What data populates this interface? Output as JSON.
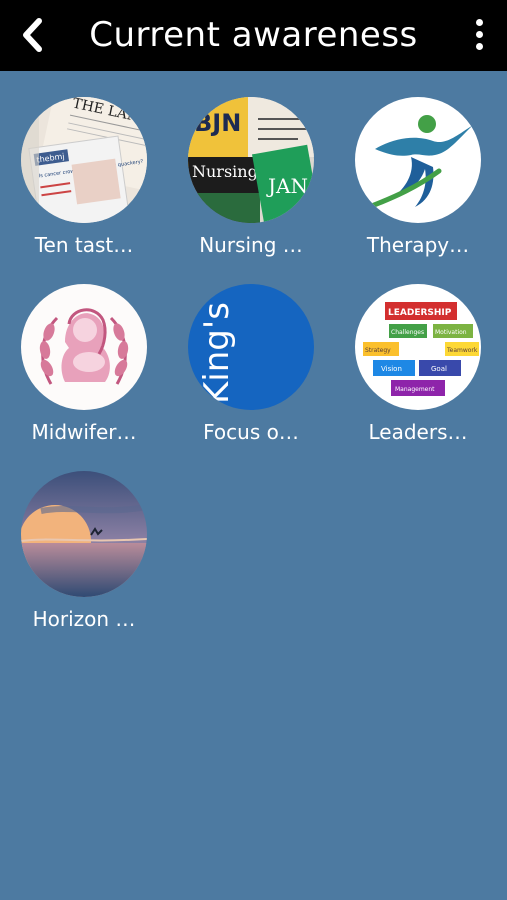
{
  "header": {
    "title": "Current awareness",
    "back_icon": "chevron-left-icon",
    "menu_icon": "more-vert-icon"
  },
  "tiles": [
    {
      "label": "Ten tast…",
      "image": "journals-lancet-bmj-thumbnail"
    },
    {
      "label": "Nursing …",
      "image": "nursing-journals-thumbnail"
    },
    {
      "label": "Therapy…",
      "image": "therapy-figure-thumbnail"
    },
    {
      "label": "Midwifer…",
      "image": "midwifery-mother-baby-thumbnail"
    },
    {
      "label": "Focus o…",
      "image": "kings-logo-thumbnail"
    },
    {
      "label": "Leaders…",
      "image": "leadership-blocks-thumbnail"
    },
    {
      "label": "Horizon …",
      "image": "horizon-sunset-thumbnail"
    }
  ],
  "image_text": {
    "lancet": "THE LANCET",
    "bmj": "thebmj",
    "bmj_article": "Is cancer crowdfunding fuelling quackery?",
    "bjn": "BJN",
    "nursing_times": "Nursing Times",
    "jan": "JAN",
    "kings": "King's",
    "leadership": "LEADERSHIP",
    "challenges": "Challenges",
    "motivation": "Motivation",
    "strategy": "Strategy",
    "teamwork": "Teamwork",
    "vision": "Vision",
    "goal": "Goal",
    "management": "Management"
  },
  "colors": {
    "background": "#4d7aa1",
    "header_bg": "#000000",
    "text": "#ffffff",
    "kings_blue": "#1565c0"
  }
}
